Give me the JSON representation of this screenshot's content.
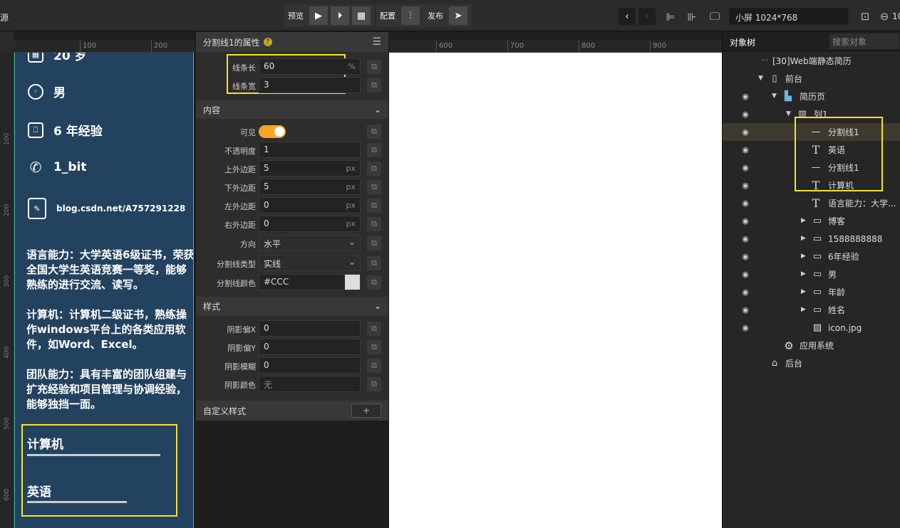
{
  "topbar": {
    "left_fragment": "源",
    "preview_label": "预览",
    "config_label": "配置",
    "publish_label": "发布",
    "screen_size": "小屏 1024*768",
    "zoom_fragment": "10"
  },
  "ruler": {
    "h_labels": [
      "100",
      "200",
      "600",
      "700",
      "800",
      "900"
    ],
    "v_labels": [
      "100",
      "200",
      "300",
      "400",
      "500",
      "600"
    ]
  },
  "resume": {
    "age_partial": "20 岁",
    "gender": "男",
    "experience": "6 年经验",
    "phone": "1_bit",
    "blog": "blog.csdn.net/A757291228",
    "para_language": "语言能力：大学英语6级证书，荣获全国大学生英语竞赛一等奖，能够熟练的进行交流、读写。",
    "para_computer": "计算机：计算机二级证书，熟练操作windows平台上的各类应用软件，如Word、Excel。",
    "para_team": "团队能力：具有丰富的团队组建与扩充经验和项目管理与协调经验，能够独挡一面。",
    "section_computer": "计算机",
    "section_english": "英语"
  },
  "props": {
    "title": "分割线1的属性",
    "line_length_label": "线条长",
    "line_length_value": "60",
    "line_length_unit": "%",
    "line_width_label": "线条宽",
    "line_width_value": "3",
    "content_section": "内容",
    "visible_label": "可见",
    "opacity_label": "不透明度",
    "opacity_value": "1",
    "margin_top_label": "上外边距",
    "margin_top_value": "5",
    "margin_bottom_label": "下外边距",
    "margin_bottom_value": "5",
    "margin_left_label": "左外边距",
    "margin_left_value": "0",
    "margin_right_label": "右外边距",
    "margin_right_value": "0",
    "px_unit": "px",
    "direction_label": "方向",
    "direction_value": "水平",
    "line_type_label": "分割线类型",
    "line_type_value": "实线",
    "line_color_label": "分割线颜色",
    "line_color_value": "#CCC",
    "style_section": "样式",
    "shadow_x_label": "阴影偏X",
    "shadow_x_value": "0",
    "shadow_y_label": "阴影偏Y",
    "shadow_y_value": "0",
    "shadow_blur_label": "阴影模糊",
    "shadow_blur_value": "0",
    "shadow_color_label": "阴影颜色",
    "shadow_color_value": "无",
    "custom_style_label": "自定义样式",
    "add_label": "+"
  },
  "tree": {
    "tab_label": "对象树",
    "search_placeholder": "搜索对象",
    "items": [
      {
        "label": "[30]Web端静态简历",
        "icon": "project-icon"
      },
      {
        "label": "前台",
        "icon": "phone-icon"
      },
      {
        "label": "简历页",
        "icon": "page-icon"
      },
      {
        "label": "列1",
        "icon": "column-icon"
      },
      {
        "label": "分割线1",
        "icon": "divider-icon"
      },
      {
        "label": "英语",
        "icon": "text-icon"
      },
      {
        "label": "分割线1",
        "icon": "divider-icon"
      },
      {
        "label": "计算机",
        "icon": "text-icon"
      },
      {
        "label": "语言能力：大学...",
        "icon": "text-icon"
      },
      {
        "label": "博客",
        "icon": "row-icon"
      },
      {
        "label": "1588888888",
        "icon": "row-icon"
      },
      {
        "label": "6年经验",
        "icon": "row-icon"
      },
      {
        "label": "男",
        "icon": "row-icon"
      },
      {
        "label": "年龄",
        "icon": "row-icon"
      },
      {
        "label": "姓名",
        "icon": "row-icon"
      },
      {
        "label": "icon.jpg",
        "icon": "image-icon"
      },
      {
        "label": "应用系统",
        "icon": "gear-icon"
      },
      {
        "label": "后台",
        "icon": "backend-icon"
      }
    ]
  },
  "colors": {
    "accent": "#f5a623",
    "highlight": "#f5e32c",
    "resume_bg": "#23425f",
    "line_color": "#CCCCCC"
  }
}
